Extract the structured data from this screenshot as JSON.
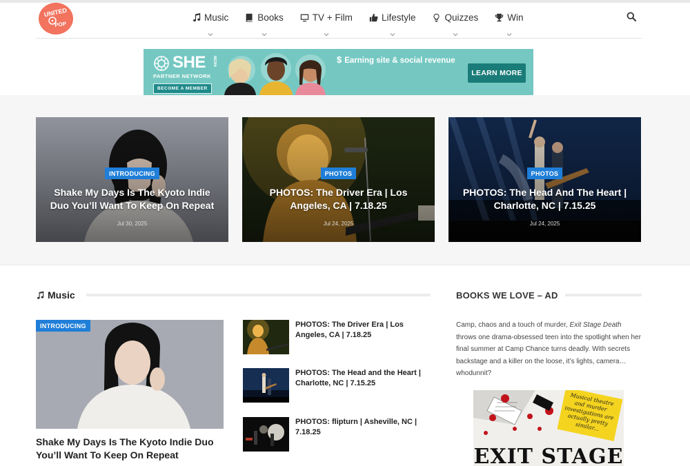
{
  "logo": {
    "text": "UNITED BY POP",
    "color": "#f2735e"
  },
  "nav": {
    "items": [
      {
        "label": "Music",
        "icon": "music-note-icon"
      },
      {
        "label": "Books",
        "icon": "book-icon"
      },
      {
        "label": "TV + Film",
        "icon": "tv-icon"
      },
      {
        "label": "Lifestyle",
        "icon": "thumbs-up-icon"
      },
      {
        "label": "Quizzes",
        "icon": "lightbulb-icon"
      },
      {
        "label": "Win",
        "icon": "trophy-icon"
      }
    ],
    "search_icon": "search-icon"
  },
  "banner": {
    "brand": "SHE",
    "brand_sub": "MEDIA",
    "network": "PARTNER NETWORK",
    "member_cta": "BECOME A MEMBER",
    "tagline": "Earning site & social revenue",
    "cta": "LEARN MORE",
    "bg_color": "#75c8c2"
  },
  "featured": [
    {
      "badge": "INTRODUCING",
      "title": "Shake My Days Is The Kyoto Indie Duo You’ll Want To Keep On Repeat",
      "date": "Jul 30, 2025"
    },
    {
      "badge": "PHOTOS",
      "title": "PHOTOS: The Driver Era | Los Angeles, CA | 7.18.25",
      "date": "Jul 24, 2025"
    },
    {
      "badge": "PHOTOS",
      "title": "PHOTOS: The Head And The Heart | Charlotte, NC | 7.15.25",
      "date": "Jul 24, 2025"
    }
  ],
  "music_section": {
    "heading": "Music",
    "main": {
      "badge": "INTRODUCING",
      "title": "Shake My Days Is The Kyoto Indie Duo You’ll Want To Keep On Repeat"
    },
    "list": [
      {
        "title": "PHOTOS: The Driver Era | Los Angeles, CA | 7.18.25"
      },
      {
        "title": "PHOTOS: The Head and the Heart | Charlotte, NC | 7.15.25"
      },
      {
        "title": "PHOTOS: flipturn | Asheville, NC | 7.18.25"
      }
    ]
  },
  "sidebar": {
    "heading": "BOOKS WE LOVE – AD",
    "text_before": "Camp, chaos and a touch of murder, ",
    "book_title": "Exit Stage Death",
    "text_after": " throws one drama-obsessed teen into the spotlight when her final summer at Camp Chance turns deadly. With secrets backstage and a killer on the loose, it’s lights, camera… whodunnit?",
    "cover_note": "Musical theatre and murder investigations are actually pretty similar...",
    "cover_title": "EXIT STAGE"
  },
  "accent_color": "#1f7ed8"
}
